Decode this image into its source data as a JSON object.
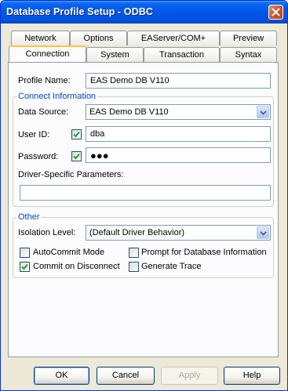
{
  "window": {
    "title": "Database Profile Setup - ODBC"
  },
  "tabs": {
    "back_row": [
      "Network",
      "Options",
      "EAServer/COM+",
      "Preview"
    ],
    "front_row": [
      "Connection",
      "System",
      "Transaction",
      "Syntax"
    ],
    "active": "Connection"
  },
  "form": {
    "profile_name_label": "Profile Name:",
    "profile_name_value": "EAS Demo DB V110",
    "connect_group_title": "Connect Information",
    "data_source_label": "Data Source:",
    "data_source_value": "EAS Demo DB V110",
    "user_id_label": "User ID:",
    "user_id_value": "dba",
    "user_id_checked": true,
    "password_label": "Password:",
    "password_value": "●●●",
    "password_checked": true,
    "driver_params_label": "Driver-Specific Parameters:",
    "driver_params_value": "",
    "other_group_title": "Other",
    "isolation_label": "Isolation Level:",
    "isolation_value": "(Default Driver Behavior)",
    "autocommit_label": "AutoCommit Mode",
    "autocommit_checked": false,
    "prompt_label": "Prompt for Database Information",
    "prompt_checked": false,
    "commit_label": "Commit on Disconnect",
    "commit_checked": true,
    "trace_label": "Generate Trace",
    "trace_checked": false
  },
  "buttons": {
    "ok": "OK",
    "cancel": "Cancel",
    "apply": "Apply",
    "help": "Help"
  },
  "colors": {
    "title_bar": "#0052de",
    "group_title": "#0046d5",
    "active_tab_accent": "#ffc83c",
    "close_button": "#d4542a"
  }
}
